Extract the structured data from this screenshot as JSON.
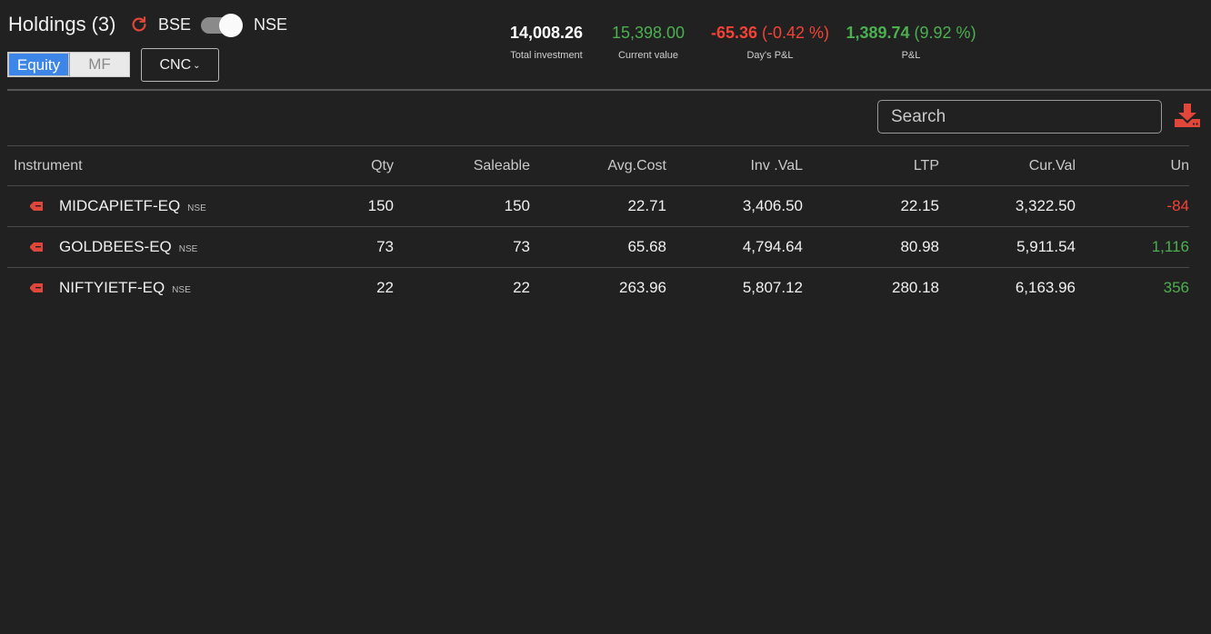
{
  "header": {
    "title": "Holdings",
    "count": "(3)",
    "exchange_left": "BSE",
    "exchange_right": "NSE",
    "segments": [
      "Equity",
      "MF"
    ],
    "product": "CNC"
  },
  "summary": {
    "total_investment": {
      "value": "14,008.26",
      "label": "Total investment"
    },
    "current_value": {
      "value": "15,398.00",
      "label": "Current value"
    },
    "days_pnl": {
      "value": "-65.36",
      "pct": "(-0.42 %)",
      "label": "Day's P&L"
    },
    "pnl": {
      "value": "1,389.74",
      "pct": "(9.92 %)",
      "label": "P&L"
    }
  },
  "search": {
    "placeholder": "Search"
  },
  "table": {
    "columns": [
      "Instrument",
      "Qty",
      "Saleable",
      "Avg.Cost",
      "Inv .VaL",
      "LTP",
      "Cur.Val",
      "Un"
    ],
    "rows": [
      {
        "symbol": "MIDCAPIETF-EQ",
        "exchange": "NSE",
        "qty": "150",
        "saleable": "150",
        "avg_cost": "22.71",
        "inv_val": "3,406.50",
        "ltp": "22.15",
        "cur_val": "3,322.50",
        "unrealised": "-84"
      },
      {
        "symbol": "GOLDBEES-EQ",
        "exchange": "NSE",
        "qty": "73",
        "saleable": "73",
        "avg_cost": "65.68",
        "inv_val": "4,794.64",
        "ltp": "80.98",
        "cur_val": "5,911.54",
        "unrealised": "1,116"
      },
      {
        "symbol": "NIFTYIETF-EQ",
        "exchange": "NSE",
        "qty": "22",
        "saleable": "22",
        "avg_cost": "263.96",
        "inv_val": "5,807.12",
        "ltp": "280.18",
        "cur_val": "6,163.96",
        "unrealised": "356"
      }
    ]
  },
  "icons": {
    "refresh": "refresh-icon",
    "download": "download-icon",
    "instrument_tag": "tag-icon"
  },
  "colors": {
    "accent": "#3d86e8",
    "profit": "#4caf50",
    "loss": "#f44336",
    "icon": "#e0463a"
  }
}
